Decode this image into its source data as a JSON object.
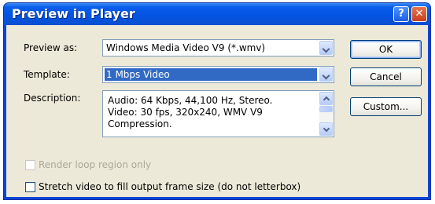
{
  "dialog": {
    "title": "Preview in Player",
    "help_glyph": "?",
    "close_glyph": "✕"
  },
  "form": {
    "preview_as_label": "Preview as:",
    "preview_as_value": "Windows Media Video V9 (*.wmv)",
    "template_label": "Template:",
    "template_value": "1 Mbps Video",
    "description_label": "Description:",
    "description_lines": [
      "Audio: 64 Kbps, 44,100 Hz, Stereo.",
      "Video: 30 fps, 320x240, WMV V9",
      "Compression."
    ]
  },
  "buttons": {
    "ok": "OK",
    "cancel": "Cancel",
    "custom": "Custom..."
  },
  "options": {
    "render_loop_label": "Render loop region only",
    "render_loop_checked": false,
    "render_loop_enabled": false,
    "stretch_label": "Stretch video to fill output frame size (do not letterbox)",
    "stretch_checked": false
  },
  "colors": {
    "title_bar": "#0a5ee8",
    "selection": "#316ac5",
    "dialog_face": "#ece9d8"
  }
}
